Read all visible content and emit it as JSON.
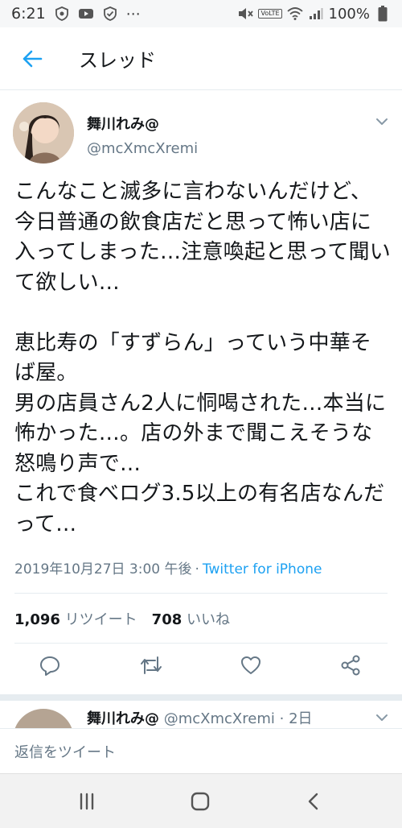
{
  "status_bar": {
    "time": "6:21",
    "more_dots": "⋯",
    "volte": "VoLTE",
    "battery": "100%"
  },
  "header": {
    "title": "スレッド"
  },
  "tweet": {
    "author_name": "舞川れみ@",
    "author_handle": "@mcXmcXremi",
    "text": "こんなこと滅多に言わないんだけど、今日普通の飲食店だと思って怖い店に入ってしまった…注意喚起と思って聞いて欲しい…\n\n恵比寿の「すずらん」っていう中華そば屋。\n男の店員さん2人に恫喝された…本当に怖かった…。店の外まで聞こえそうな怒鳴り声で…\nこれで食べログ3.5以上の有名店なんだって…",
    "timestamp": "2019年10月27日 3:00 午後",
    "separator": "·",
    "source": "Twitter for iPhone",
    "retweet_count": "1,096",
    "retweet_label": "リツイート",
    "like_count": "708",
    "like_label": "いいね"
  },
  "icons": {
    "accent": "#1da1f2",
    "secondary": "#657786"
  },
  "next_tweet": {
    "author_name": "舞川れみ@",
    "author_handle": "@mcXmcXremi",
    "separator": "·",
    "age": "2日"
  },
  "reply": {
    "placeholder": "返信をツイート"
  }
}
